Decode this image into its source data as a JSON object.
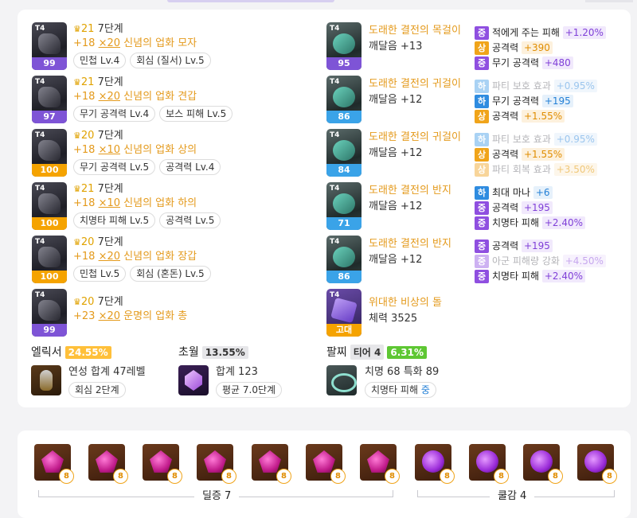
{
  "equipment": [
    {
      "tier": "T4",
      "quality": "99",
      "qcolor": "purple",
      "level": "21",
      "stage": "7단계",
      "plus": "+18",
      "mul": "×20",
      "name": "신념의 업화 모자",
      "chips": [
        "민첩 Lv.4",
        "회심 (질서) Lv.5"
      ]
    },
    {
      "tier": "T4",
      "quality": "97",
      "qcolor": "purple",
      "level": "21",
      "stage": "7단계",
      "plus": "+18",
      "mul": "×20",
      "name": "신념의 업화 견갑",
      "chips": [
        "무기 공격력 Lv.4",
        "보스 피해 Lv.5"
      ]
    },
    {
      "tier": "T4",
      "quality": "100",
      "qcolor": "orange",
      "level": "20",
      "stage": "7단계",
      "plus": "+18",
      "mul": "×10",
      "name": "신념의 업화 상의",
      "chips": [
        "무기 공격력 Lv.5",
        "공격력 Lv.4"
      ]
    },
    {
      "tier": "T4",
      "quality": "100",
      "qcolor": "orange",
      "level": "21",
      "stage": "7단계",
      "plus": "+18",
      "mul": "×10",
      "name": "신념의 업화 하의",
      "chips": [
        "치명타 피해 Lv.5",
        "공격력 Lv.5"
      ]
    },
    {
      "tier": "T4",
      "quality": "100",
      "qcolor": "orange",
      "level": "20",
      "stage": "7단계",
      "plus": "+18",
      "mul": "×20",
      "name": "신념의 업화 장갑",
      "chips": [
        "민첩 Lv.5",
        "회심 (혼돈) Lv.5"
      ]
    },
    {
      "tier": "T4",
      "quality": "99",
      "qcolor": "purple",
      "level": "20",
      "stage": "7단계",
      "plus": "+23",
      "mul": "×20",
      "name": "운명의 업화 총",
      "chips": []
    }
  ],
  "accessories": [
    {
      "tier": "T4",
      "quality": "95",
      "qcolor": "purple",
      "name": "도래한 결전의 목걸이",
      "sub": "깨달음 +13",
      "effects": [
        {
          "grade": "중",
          "g": "mid",
          "label": "적에게 주는 피해",
          "value": "+1.20%",
          "faint": false
        },
        {
          "grade": "상",
          "g": "up",
          "label": "공격력",
          "value": "+390",
          "faint": false
        },
        {
          "grade": "중",
          "g": "mid",
          "label": "무기 공격력",
          "value": "+480",
          "faint": false
        }
      ]
    },
    {
      "tier": "T4",
      "quality": "86",
      "qcolor": "blue",
      "name": "도래한 결전의 귀걸이",
      "sub": "깨달음 +12",
      "effects": [
        {
          "grade": "하",
          "g": "low",
          "label": "파티 보호 효과",
          "value": "+0.95%",
          "faint": true
        },
        {
          "grade": "하",
          "g": "low",
          "label": "무기 공격력",
          "value": "+195",
          "faint": false
        },
        {
          "grade": "상",
          "g": "up",
          "label": "공격력",
          "value": "+1.55%",
          "faint": false
        }
      ]
    },
    {
      "tier": "T4",
      "quality": "84",
      "qcolor": "blue",
      "name": "도래한 결전의 귀걸이",
      "sub": "깨달음 +12",
      "effects": [
        {
          "grade": "하",
          "g": "low",
          "label": "파티 보호 효과",
          "value": "+0.95%",
          "faint": true
        },
        {
          "grade": "상",
          "g": "up",
          "label": "공격력",
          "value": "+1.55%",
          "faint": false
        },
        {
          "grade": "상",
          "g": "up",
          "label": "파티 회복 효과",
          "value": "+3.50%",
          "faint": true
        }
      ]
    },
    {
      "tier": "T4",
      "quality": "71",
      "qcolor": "blue",
      "name": "도래한 결전의 반지",
      "sub": "깨달음 +12",
      "effects": [
        {
          "grade": "하",
          "g": "low",
          "label": "최대 마나",
          "value": "+6",
          "faint": false
        },
        {
          "grade": "중",
          "g": "mid",
          "label": "공격력",
          "value": "+195",
          "faint": false
        },
        {
          "grade": "중",
          "g": "mid",
          "label": "치명타 피해",
          "value": "+2.40%",
          "faint": false
        }
      ]
    },
    {
      "tier": "T4",
      "quality": "86",
      "qcolor": "blue",
      "name": "도래한 결전의 반지",
      "sub": "깨달음 +12",
      "effects": [
        {
          "grade": "중",
          "g": "mid",
          "label": "공격력",
          "value": "+195",
          "faint": false
        },
        {
          "grade": "중",
          "g": "mid",
          "label": "아군 피해량 강화",
          "value": "+4.50%",
          "faint": true
        },
        {
          "grade": "중",
          "g": "mid",
          "label": "치명타 피해",
          "value": "+2.40%",
          "faint": false
        }
      ]
    }
  ],
  "stone": {
    "tier": "T4",
    "quality": "고대",
    "qcolor": "orange",
    "name": "위대한 비상의 돌",
    "sub": "체력 3525"
  },
  "elixir": {
    "title": "엘릭서",
    "percent": "24.55%",
    "line1": "연성 합계 47레벨",
    "chip": "회심 2단계"
  },
  "transcend": {
    "title": "초월",
    "percent": "13.55%",
    "line1": "합계 123",
    "chip": "평균 7.0단계"
  },
  "bracelet": {
    "title": "팔찌",
    "tier": "티어 4",
    "percent": "6.31%",
    "line1": "치명 68  특화 89",
    "chip_label": "치명타 피해",
    "chip_grade": "중"
  },
  "gems": {
    "items": [
      {
        "type": "red",
        "level": "8"
      },
      {
        "type": "red",
        "level": "8"
      },
      {
        "type": "red",
        "level": "8"
      },
      {
        "type": "red",
        "level": "8"
      },
      {
        "type": "red",
        "level": "8"
      },
      {
        "type": "red",
        "level": "8"
      },
      {
        "type": "red",
        "level": "8"
      },
      {
        "type": "purple",
        "level": "8"
      },
      {
        "type": "purple",
        "level": "8"
      },
      {
        "type": "purple",
        "level": "8"
      },
      {
        "type": "purple",
        "level": "8"
      }
    ],
    "group1_label": "딜증 7",
    "group2_label": "쿨감 4"
  }
}
